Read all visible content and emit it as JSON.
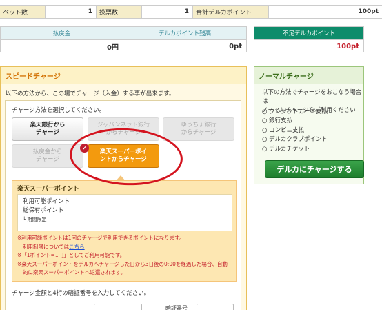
{
  "summary": {
    "bet_count_label": "ベット数",
    "bet_count": "1",
    "vote_count_label": "投票数",
    "vote_count": "1",
    "total_label": "合計デルカポイント",
    "total": "100pt"
  },
  "balances": {
    "refund_label": "払戻金",
    "refund": "0円",
    "remaining_label": "デルカポイント残高",
    "remaining": "0pt",
    "shortage_label": "不足デルカポイント",
    "shortage": "100pt"
  },
  "speed": {
    "title": "スピードチャージ",
    "desc": "以下の方法から、この場でチャージ（入金）する事が出来ます。",
    "choose": "チャージ方法を選択してください。",
    "buttons": {
      "rakuten_bank": "楽天銀行から\nチャージ",
      "japannet": "ジャパンネット銀行\nからチャージ",
      "yucho": "ゆうちょ銀行\nからチャージ",
      "refund": "払戻金から\nチャージ",
      "rakuten_point": "楽天スーパーポイ\nントからチャージ"
    },
    "rakuten_title": "楽天スーパーポイント",
    "available": "利用可能ポイント",
    "total_held": "総保有ポイント",
    "limited": "└ 期間限定",
    "note1": "※利用可能ポイントは1回のチャージで利用できるポイントになります。",
    "note2": "利用制限については",
    "note2_link": "こちら",
    "note3": "※「1ポイント=1円」としてご利用可能です。",
    "note4": "※楽天スーパーポイントをデルカへチャージした日から3日後の0:00を経過した場合、自動",
    "note5": "的に楽天スーパーポイントへ返還されます。",
    "amount_instruction": "チャージ金額と4桁の暗証番号を入力してください。",
    "pin_label": "暗証番号"
  },
  "normal": {
    "title": "ノーマルチャージ",
    "desc1": "以下の方法でチャージをおこなう場合は",
    "desc2": "ノーマルチャージをご利用ください",
    "methods": [
      "クレジットカード支払",
      "銀行支払",
      "コンビニ支払",
      "デルカクラブポイント",
      "デルカチケット"
    ],
    "button": "デルカにチャージする"
  },
  "colors": {
    "accent_orange": "#f39a0e",
    "shortage_red": "#c4202c",
    "annotation_ring": "#d4141f"
  }
}
